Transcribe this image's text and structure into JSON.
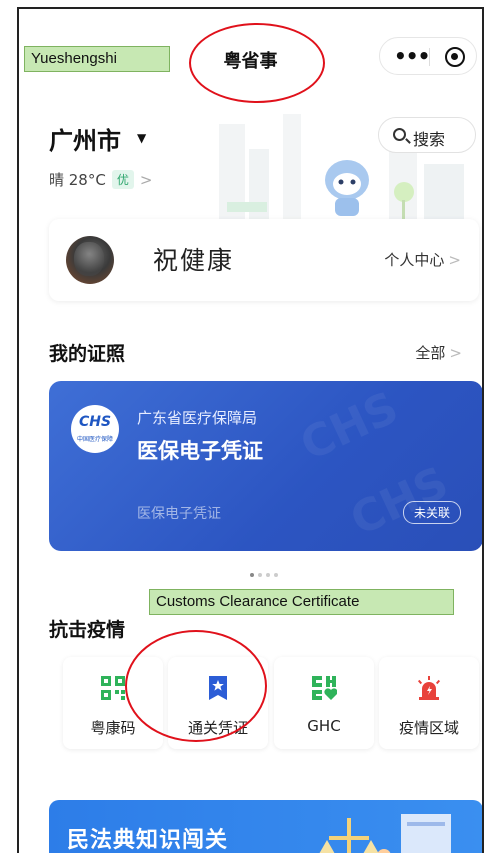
{
  "header": {
    "title": "粤省事"
  },
  "annotations": {
    "app_label": "Yueshengshi",
    "feature_label": "Customs Clearance Certificate"
  },
  "location": {
    "city": "广州市",
    "weather": "晴 28°C",
    "air_quality": "优"
  },
  "search": {
    "label": "搜索"
  },
  "profile": {
    "name": "祝健康",
    "center_link": "个人中心"
  },
  "certificates": {
    "heading": "我的证照",
    "all_link": "全部",
    "card": {
      "logo_text": "CHS",
      "logo_subtext": "中国医疗保障",
      "issuer": "广东省医疗保障局",
      "name": "医保电子凭证",
      "subtitle": "医保电子凭证",
      "status": "未关联"
    },
    "page_count": 4,
    "active_page": 1
  },
  "epidemic": {
    "heading": "抗击疫情",
    "tiles": [
      {
        "label": "粤康码",
        "icon": "qr-code-icon",
        "color": "#2fb35a"
      },
      {
        "label": "通关凭证",
        "icon": "bookmark-star-icon",
        "color": "#2c5dd6"
      },
      {
        "label": "GHC",
        "icon": "ghc-heart-icon",
        "color": "#2fb35a"
      },
      {
        "label": "疫情区域",
        "icon": "alert-siren-icon",
        "color": "#e8423b"
      }
    ]
  },
  "banner": {
    "text": "民法典知识闯关"
  },
  "colors": {
    "brand_blue": "#2c55c2",
    "highlight_red": "#e0111b",
    "label_green": "#c7e8b3"
  }
}
